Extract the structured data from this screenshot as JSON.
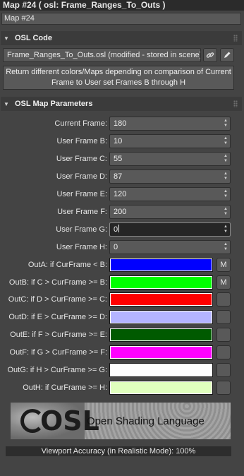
{
  "window": {
    "title": "Map #24  ( osl: Frame_Ranges_To_Outs )",
    "map_name": "Map #24"
  },
  "osl_code": {
    "header": "OSL Code",
    "file_label": "Frame_Ranges_To_Outs.osl (modified - stored in scene)",
    "description_line1": "Return different colors/Maps depending on comparison of Current",
    "description_line2": "Frame to User set Frames B through H",
    "link_icon": "chain-link-icon",
    "edit_icon": "pencil-icon"
  },
  "params": {
    "header": "OSL Map Parameters",
    "frames": [
      {
        "label": "Current Frame:",
        "value": "180"
      },
      {
        "label": "User Frame B:",
        "value": "10"
      },
      {
        "label": "User Frame C:",
        "value": "55"
      },
      {
        "label": "User Frame D:",
        "value": "87"
      },
      {
        "label": "User Frame E:",
        "value": "120"
      },
      {
        "label": "User Frame F:",
        "value": "200"
      },
      {
        "label": "User Frame G:",
        "value": "0"
      },
      {
        "label": "User Frame H:",
        "value": "0"
      }
    ],
    "outputs": [
      {
        "label": "OutA: if CurFrame < B:",
        "color": "#0000ff",
        "map": "M"
      },
      {
        "label": "OutB: if C > CurFrame >= B:",
        "color": "#00ff00",
        "map": "M"
      },
      {
        "label": "OutC: if D > CurFrame >= C:",
        "color": "#ff0000",
        "map": ""
      },
      {
        "label": "OutD: if E > CurFrame >= D:",
        "color": "#b4b4ff",
        "map": ""
      },
      {
        "label": "OutE: if F > CurFrame >= E:",
        "color": "#005a00",
        "map": ""
      },
      {
        "label": "OutF: if G > CurFrame >= F:",
        "color": "#ff00ff",
        "map": ""
      },
      {
        "label": "OutG: if H > CurFrame >= G:",
        "color": "#ffffff",
        "map": ""
      },
      {
        "label": "OutH: if CurFrame >= H:",
        "color": "#e0ffbe",
        "map": ""
      }
    ]
  },
  "logo": {
    "mark": "OSL",
    "text": "Open Shading Language"
  },
  "footer": {
    "viewport_accuracy": "Viewport Accuracy (in Realistic Mode): 100%"
  }
}
